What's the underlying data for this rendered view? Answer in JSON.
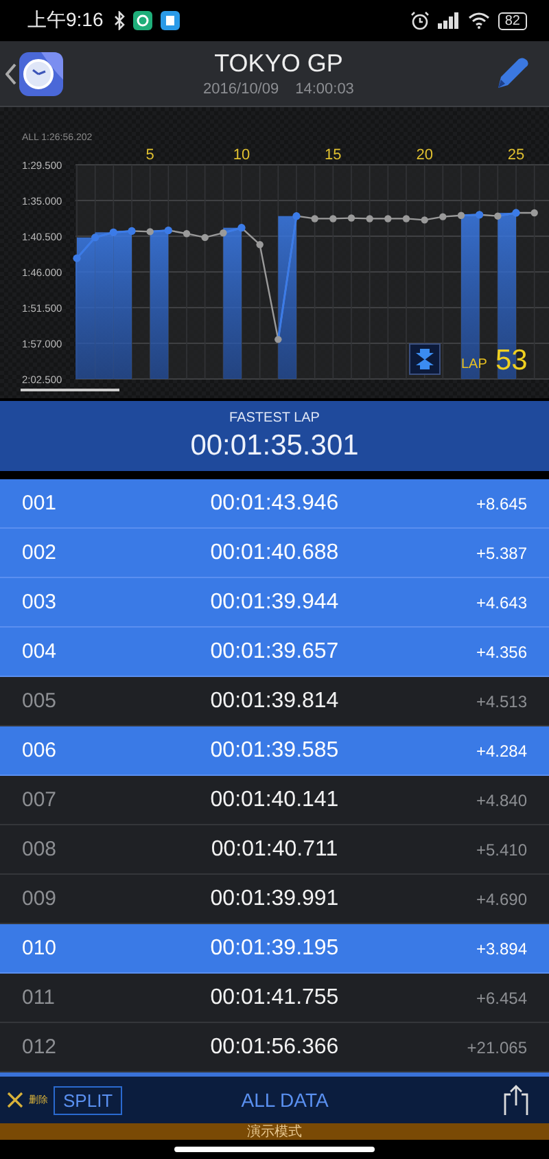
{
  "status_bar": {
    "time": "上午9:16",
    "battery": "82"
  },
  "header": {
    "title": "TOKYO GP",
    "date": "2016/10/09",
    "time": "14:00:03"
  },
  "chart": {
    "total": "ALL 1:26:56.202",
    "lap_label": "LAP",
    "lap_value": "53",
    "x_labels": [
      "5",
      "10",
      "15",
      "20",
      "25"
    ],
    "y_labels": [
      "1:29.500",
      "1:35.000",
      "1:40.500",
      "1:46.000",
      "1:51.500",
      "1:57.000",
      "2:02.500"
    ]
  },
  "fastest": {
    "label": "FASTEST LAP",
    "time": "00:01:35.301"
  },
  "laps": [
    {
      "number": "001",
      "time": "00:01:43.946",
      "diff": "+8.645",
      "best": true
    },
    {
      "number": "002",
      "time": "00:01:40.688",
      "diff": "+5.387",
      "best": true
    },
    {
      "number": "003",
      "time": "00:01:39.944",
      "diff": "+4.643",
      "best": true
    },
    {
      "number": "004",
      "time": "00:01:39.657",
      "diff": "+4.356",
      "best": true
    },
    {
      "number": "005",
      "time": "00:01:39.814",
      "diff": "+4.513",
      "best": false
    },
    {
      "number": "006",
      "time": "00:01:39.585",
      "diff": "+4.284",
      "best": true
    },
    {
      "number": "007",
      "time": "00:01:40.141",
      "diff": "+4.840",
      "best": false
    },
    {
      "number": "008",
      "time": "00:01:40.711",
      "diff": "+5.410",
      "best": false
    },
    {
      "number": "009",
      "time": "00:01:39.991",
      "diff": "+4.690",
      "best": false
    },
    {
      "number": "010",
      "time": "00:01:39.195",
      "diff": "+3.894",
      "best": true
    },
    {
      "number": "011",
      "time": "00:01:41.755",
      "diff": "+6.454",
      "best": false
    },
    {
      "number": "012",
      "time": "00:01:56.366",
      "diff": "+21.065",
      "best": false
    }
  ],
  "toolbar": {
    "delete_label": "删除",
    "split": "SPLIT",
    "all_data": "ALL DATA"
  },
  "demo_banner": "演示模式"
}
